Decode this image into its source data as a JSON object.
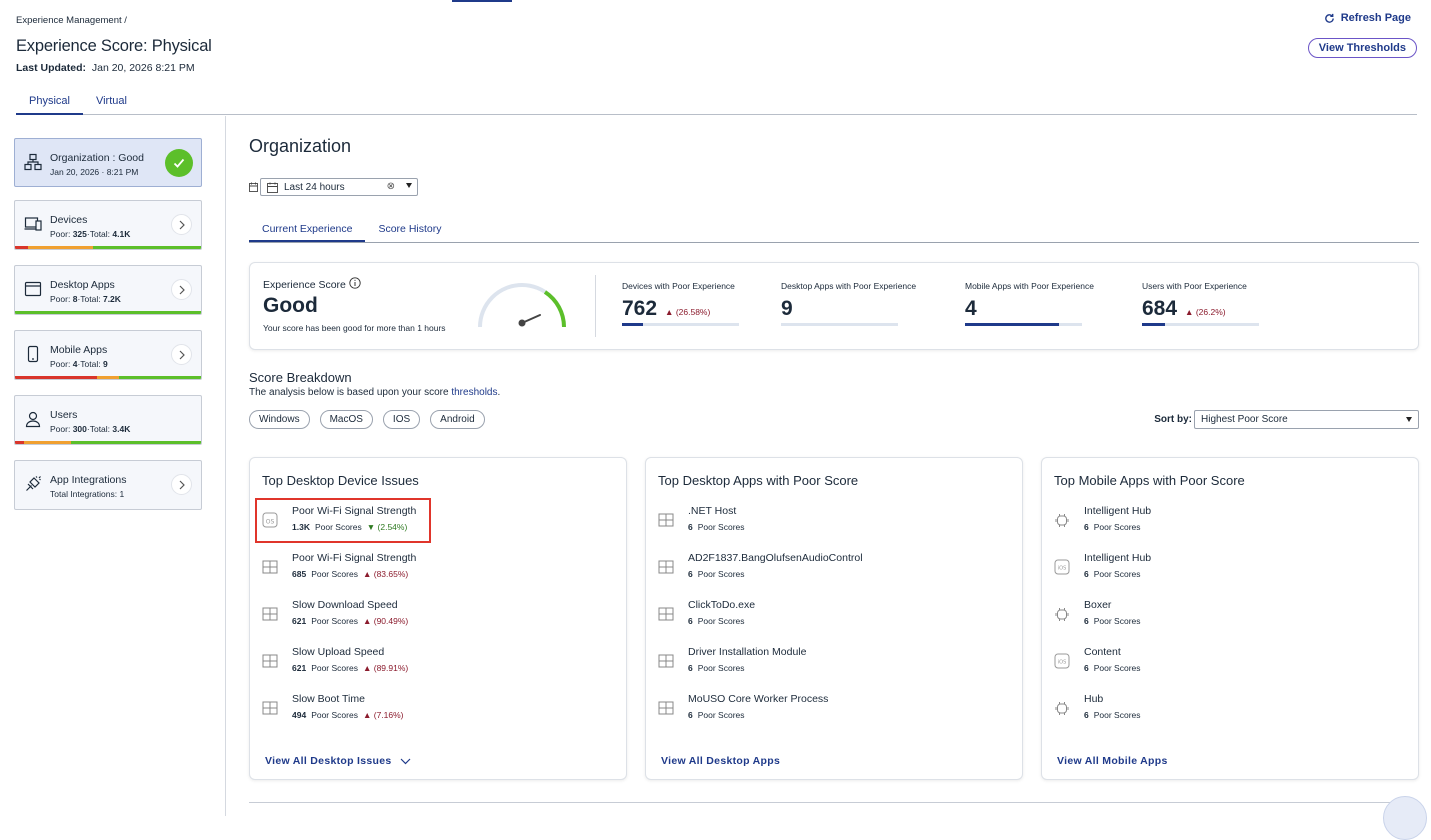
{
  "header": {
    "breadcrumb": "Experience Management  /",
    "title": "Experience Score: Physical",
    "last_updated_label": "Last Updated:",
    "last_updated_value": "Jan 20, 2026 8:21 PM",
    "refresh_label": "Refresh Page",
    "thresholds_label": "View Thresholds"
  },
  "top_tabs": [
    {
      "label": "Physical",
      "active": true
    },
    {
      "label": "Virtual",
      "active": false
    }
  ],
  "sidebar": {
    "items": [
      {
        "title": "Organization : Good",
        "sub": "Jan 20, 2026 · 8:21 PM",
        "icon": "org-chart-icon",
        "selected": true
      },
      {
        "title": "Devices",
        "poor_label": "Poor:",
        "poor": "325",
        "total_label": "·Total:",
        "total": "4.1K",
        "icon": "devices-icon"
      },
      {
        "title": "Desktop Apps",
        "poor_label": "Poor:",
        "poor": "8",
        "total_label": "·Total:",
        "total": "7.2K",
        "icon": "desktop-app-icon"
      },
      {
        "title": "Mobile Apps",
        "poor_label": "Poor:",
        "poor": "4",
        "total_label": "·Total:",
        "total": "9",
        "icon": "mobile-icon"
      },
      {
        "title": "Users",
        "poor_label": "Poor:",
        "poor": "300",
        "total_label": "·Total:",
        "total": "3.4K",
        "icon": "user-icon"
      },
      {
        "title": "App Integrations",
        "sub": "Total Integrations: 1",
        "icon": "integration-icon"
      }
    ]
  },
  "main": {
    "org_title": "Organization",
    "date_range": "Last 24 hours",
    "subtabs": [
      {
        "label": "Current Experience",
        "active": true
      },
      {
        "label": "Score History",
        "active": false
      }
    ],
    "experience_score": {
      "label": "Experience Score",
      "value": "Good",
      "desc": "Your score has been good for more than 1 hours"
    },
    "metrics": [
      {
        "label": "Devices with Poor Experience",
        "value": "762",
        "change": "(26.58%)",
        "progress": 0.18
      },
      {
        "label": "Desktop Apps with Poor Experience",
        "value": "9",
        "change": "",
        "progress": 0
      },
      {
        "label": "Mobile Apps with Poor Experience",
        "value": "4",
        "change": "",
        "progress": 0.8
      },
      {
        "label": "Users with Poor Experience",
        "value": "684",
        "change": "(26.2%)",
        "progress": 0.2
      }
    ],
    "score_breakdown": {
      "title": "Score Breakdown",
      "desc_prefix": "The analysis below is based upon your score ",
      "desc_link": "thresholds",
      "desc_suffix": ".",
      "chips": [
        "Windows",
        "MacOS",
        "IOS",
        "Android"
      ],
      "sort_label": "Sort by:",
      "sort_value": "Highest Poor Score"
    },
    "panels": [
      {
        "title": "Top Desktop Device Issues",
        "link": "View All Desktop Issues",
        "items": [
          {
            "name": "Poor Wi-Fi Signal Strength",
            "count": "1.3K",
            "unit": "Poor Scores",
            "change": "(2.54%)",
            "dir": "down",
            "icon": "macos-icon"
          },
          {
            "name": "Poor Wi-Fi Signal Strength",
            "count": "685",
            "unit": "Poor Scores",
            "change": "(83.65%)",
            "dir": "up",
            "icon": "windows-icon"
          },
          {
            "name": "Slow Download Speed",
            "count": "621",
            "unit": "Poor Scores",
            "change": "(90.49%)",
            "dir": "up",
            "icon": "windows-icon"
          },
          {
            "name": "Slow Upload Speed",
            "count": "621",
            "unit": "Poor Scores",
            "change": "(89.91%)",
            "dir": "up",
            "icon": "windows-icon"
          },
          {
            "name": "Slow Boot Time",
            "count": "494",
            "unit": "Poor Scores",
            "change": "(7.16%)",
            "dir": "up",
            "icon": "windows-icon"
          }
        ]
      },
      {
        "title": "Top Desktop Apps with Poor Score",
        "link": "View All Desktop Apps",
        "items": [
          {
            "name": ".NET Host",
            "count": "6",
            "unit": "Poor Scores",
            "icon": "windows-icon"
          },
          {
            "name": "AD2F1837.BangOlufsenAudioControl",
            "count": "6",
            "unit": "Poor Scores",
            "icon": "windows-icon"
          },
          {
            "name": "ClickToDo.exe",
            "count": "6",
            "unit": "Poor Scores",
            "icon": "windows-icon"
          },
          {
            "name": "Driver Installation Module",
            "count": "6",
            "unit": "Poor Scores",
            "icon": "windows-icon"
          },
          {
            "name": "MoUSO Core Worker Process",
            "count": "6",
            "unit": "Poor Scores",
            "icon": "windows-icon"
          }
        ]
      },
      {
        "title": "Top Mobile Apps with Poor Score",
        "link": "View All Mobile Apps",
        "items": [
          {
            "name": "Intelligent Hub",
            "count": "6",
            "unit": "Poor Scores",
            "icon": "android-icon"
          },
          {
            "name": "Intelligent Hub",
            "count": "6",
            "unit": "Poor Scores",
            "icon": "ios-icon"
          },
          {
            "name": "Boxer",
            "count": "6",
            "unit": "Poor Scores",
            "icon": "android-icon"
          },
          {
            "name": "Content",
            "count": "6",
            "unit": "Poor Scores",
            "icon": "ios-icon"
          },
          {
            "name": "Hub",
            "count": "6",
            "unit": "Poor Scores",
            "icon": "android-icon"
          }
        ]
      }
    ]
  },
  "colors": {
    "accent": "#1f3a8a",
    "good": "#5cbf2a",
    "poor": "#d9352b",
    "fair": "#f0a030",
    "up": "#8b1b2d",
    "down": "#2f7a22"
  }
}
